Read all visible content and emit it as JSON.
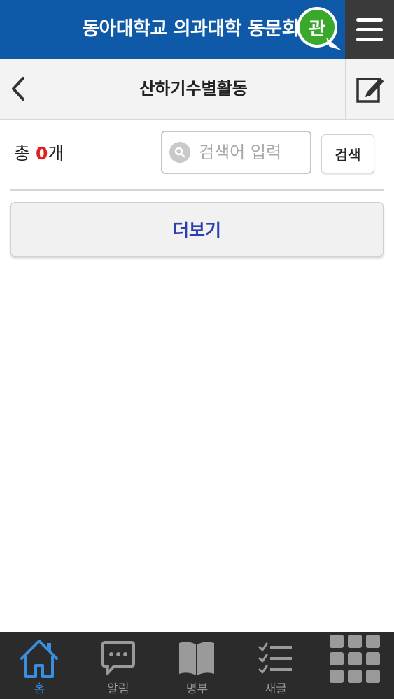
{
  "header": {
    "app_title": "동아대학교 의과대학 동문회",
    "admin_badge": "관"
  },
  "subheader": {
    "title": "산하기수별활동"
  },
  "listing": {
    "count_prefix": "총 ",
    "count_value": "0",
    "count_suffix": "개"
  },
  "search": {
    "placeholder": "검색어 입력",
    "button_label": "검색"
  },
  "more_button": {
    "label": "더보기"
  },
  "bottom_nav": {
    "items": [
      {
        "label": "홈",
        "icon": "home-icon",
        "active": true
      },
      {
        "label": "알림",
        "icon": "chat-bubble-icon",
        "active": false
      },
      {
        "label": "명부",
        "icon": "book-icon",
        "active": false
      },
      {
        "label": "새글",
        "icon": "checklist-icon",
        "active": false
      },
      {
        "label": "",
        "icon": "grid-icon",
        "active": false
      }
    ]
  },
  "colors": {
    "header_blue": "#0f5aa8",
    "badge_green": "#3aa82a",
    "count_red": "#e02020",
    "more_text_blue": "#2d3fae",
    "nav_active_blue": "#3a8ee0",
    "nav_bg": "#2b2b2b"
  }
}
